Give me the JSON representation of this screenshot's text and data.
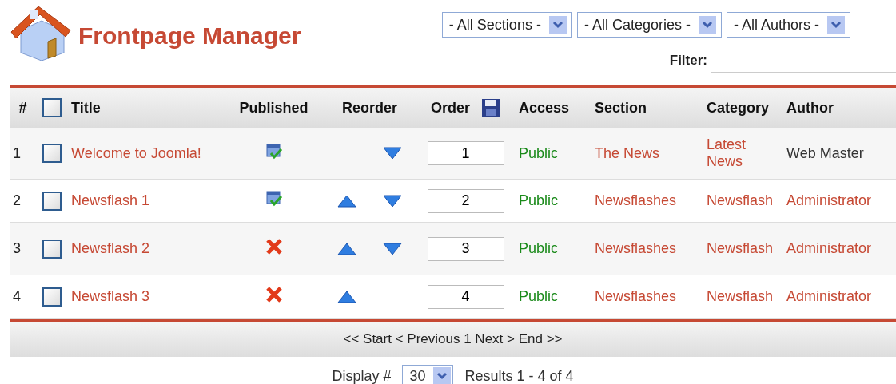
{
  "header": {
    "title": "Frontpage Manager"
  },
  "filters": [
    {
      "label": "- All Sections -"
    },
    {
      "label": "- All Categories -"
    },
    {
      "label": "- All Authors -"
    }
  ],
  "filter": {
    "label": "Filter:"
  },
  "table": {
    "all_checked": false,
    "columns": [
      "#",
      "Title",
      "Published",
      "Reorder",
      "Order",
      "Access",
      "Section",
      "Category",
      "Author"
    ],
    "rows": [
      {
        "number": "1",
        "checked": false,
        "title": "Welcome to Joomla!",
        "published": true,
        "can_move_up": false,
        "can_move_down": true,
        "order": "1",
        "access": "Public",
        "section": "The News",
        "category": "Latest News",
        "author": "Web Master",
        "author_linked": false
      },
      {
        "number": "2",
        "checked": false,
        "title": "Newsflash 1",
        "published": true,
        "can_move_up": true,
        "can_move_down": true,
        "order": "2",
        "access": "Public",
        "section": "Newsflashes",
        "category": "Newsflash",
        "author": "Administrator",
        "author_linked": true
      },
      {
        "number": "3",
        "checked": false,
        "title": "Newsflash 2",
        "published": false,
        "can_move_up": true,
        "can_move_down": true,
        "order": "3",
        "access": "Public",
        "section": "Newsflashes",
        "category": "Newsflash",
        "author": "Administrator",
        "author_linked": true
      },
      {
        "number": "4",
        "checked": false,
        "title": "Newsflash 3",
        "published": false,
        "can_move_up": true,
        "can_move_down": false,
        "order": "4",
        "access": "Public",
        "section": "Newsflashes",
        "category": "Newsflash",
        "author": "Administrator",
        "author_linked": true
      }
    ]
  },
  "pagination": {
    "text": "<< Start < Previous 1 Next > End >>"
  },
  "footer": {
    "display_label": "Display #",
    "display_value": "30",
    "results": "Results 1 - 4 of 4"
  }
}
